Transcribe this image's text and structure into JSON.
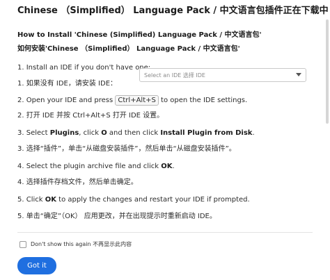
{
  "dialog": {
    "title": "Chinese （Simplified） Language Pack / 中文语言包插件正在下载中",
    "subtitle_en": "How to Install 'Chinese (Simplified) Language Pack / 中文语言包'",
    "subtitle_zh": "如何安装'Chinese （Simplified） Language Pack / 中文语言包'",
    "steps": [
      {
        "en": "1. Install an IDE if you don't have one:",
        "zh": "1. 如果没有 IDE，请安装 IDE："
      },
      {
        "en_before": "2. Open your IDE and press ",
        "shortcut": "Ctrl+Alt+S",
        "en_after": " to open the IDE settings.",
        "zh": "2. 打开 IDE 并按 Ctrl+Alt+S 打开 IDE 设置。"
      },
      {
        "en_prefix": "3. Select ",
        "plugins": "Plugins",
        "en_mid1": ", click ",
        "gear": "O",
        "en_mid2": " and then click ",
        "install_from_disk": "Install Plugin from Disk",
        "en_end": ".",
        "zh": "3. 选择“插件”，单击“从磁盘安装插件”，然后单击“从磁盘安装插件”。"
      },
      {
        "en_prefix": "4. Select the plugin archive file and click ",
        "ok": "OK",
        "en_end": ".",
        "zh": "4. 选择插件存档文件，然后单击确定。"
      },
      {
        "en_prefix": "5. Click ",
        "ok": "OK",
        "en_end": " to apply the changes and restart your IDE if prompted.",
        "zh": "5. 单击“确定”（OK） 应用更改，并在出现提示时重新启动 IDE。"
      }
    ],
    "ide_select": {
      "placeholder": "Select an IDE 选择 IDE"
    },
    "dont_show_label": "Don't show this again 不再显示此内容",
    "got_it_label": "Got it"
  }
}
